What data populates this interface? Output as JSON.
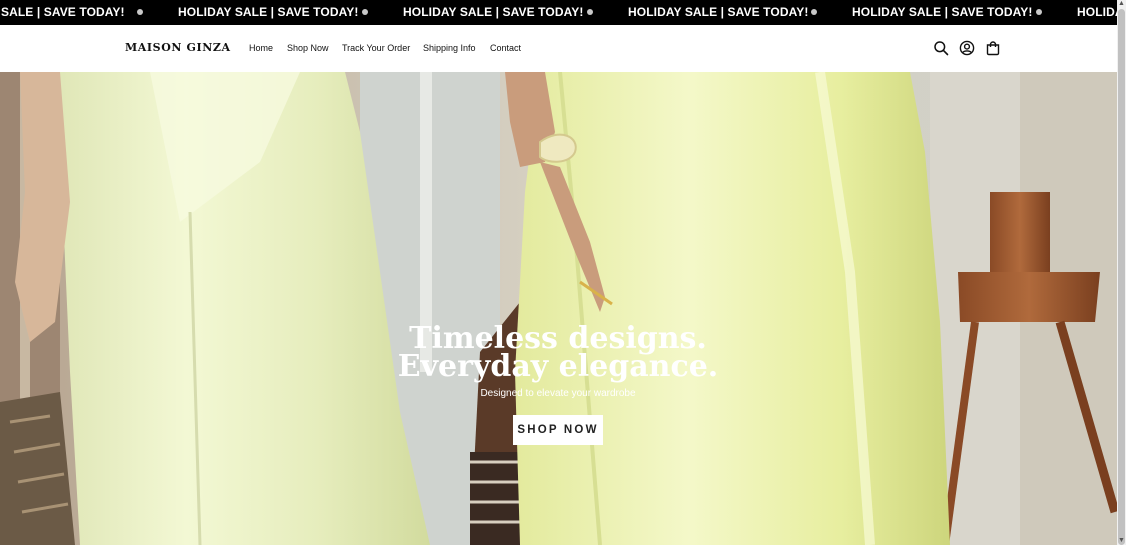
{
  "announcement": {
    "text": "HOLIDAY SALE | SAVE TODAY!",
    "partial_left": "SALE | SAVE TODAY!",
    "partial_right": "HOLIDA"
  },
  "header": {
    "logo": "MAISON GINZA",
    "nav": {
      "home": "Home",
      "shop": "Shop Now",
      "track": "Track Your Order",
      "shipping": "Shipping Info",
      "contact": "Contact"
    },
    "icons": {
      "search": "search-icon",
      "account": "account-icon",
      "cart": "cart-icon"
    }
  },
  "hero": {
    "title": "Timeless designs. Everyday elegance.",
    "subtitle": "Designed to elevate your wardrobe",
    "button": "SHOP NOW"
  },
  "colors": {
    "ticker_bg": "#000000",
    "dress": "#f2f6c9",
    "satin": "#eef3b0"
  }
}
